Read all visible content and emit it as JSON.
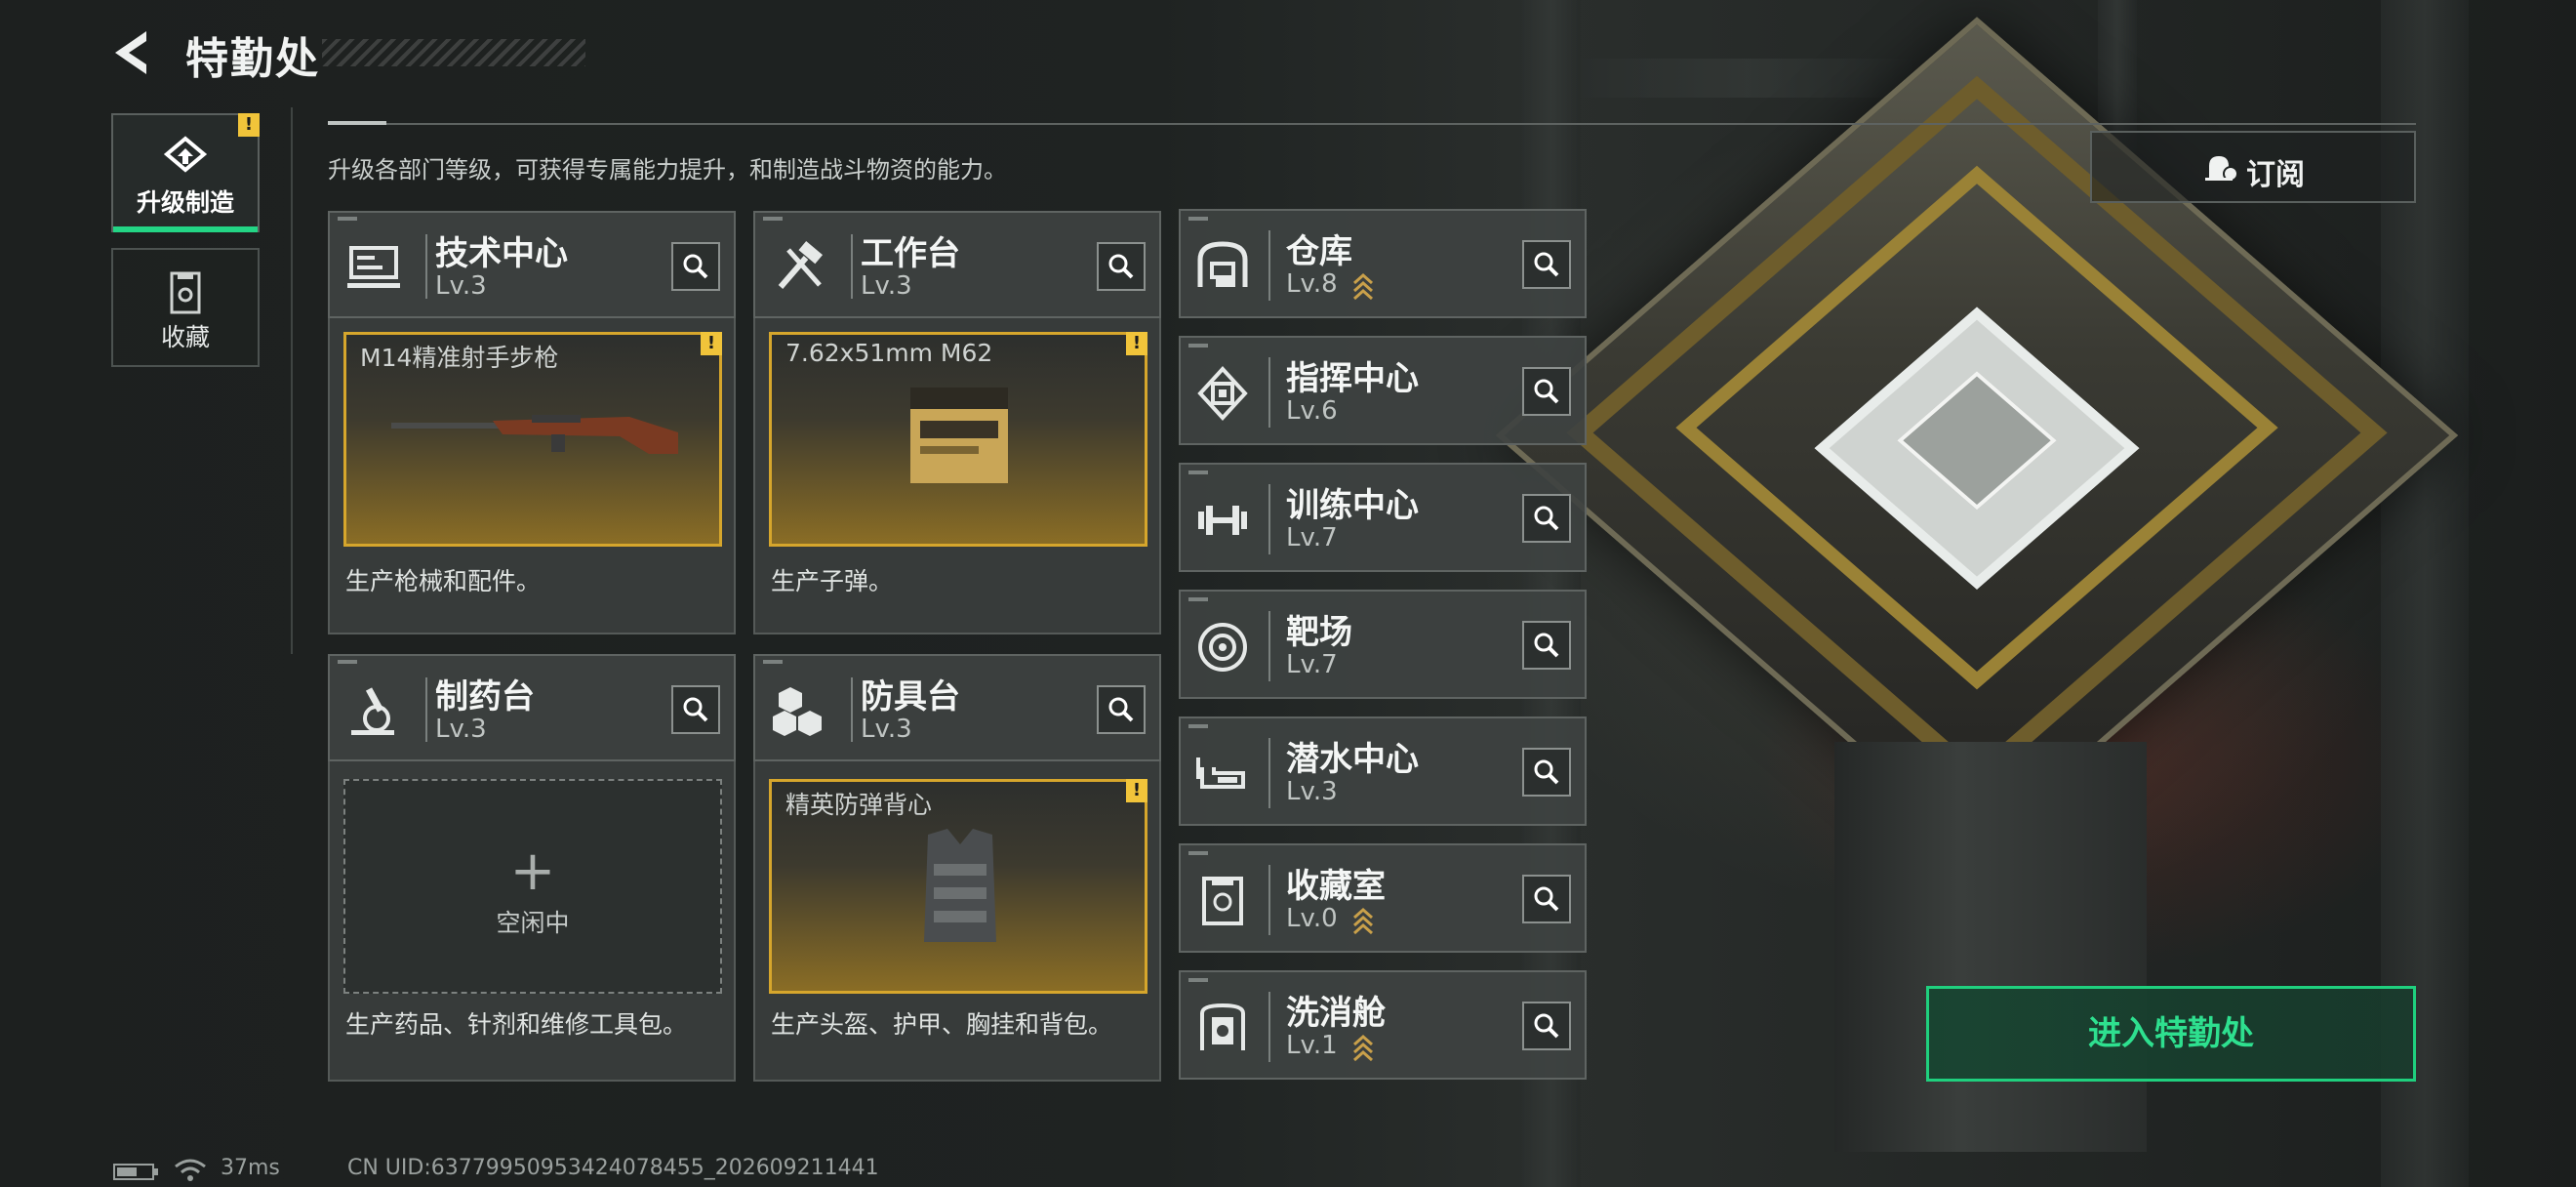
{
  "header": {
    "title": "特勤处",
    "subtitle": "升级各部门等级，可获得专属能力提升，和制造战斗物资的能力。"
  },
  "tabs": [
    {
      "label": "升级制造",
      "alert": "!"
    },
    {
      "label": "收藏"
    }
  ],
  "departments": [
    {
      "name": "技术中心",
      "level": "Lv.3",
      "slot_item": "M14精准射手步枪",
      "alert": "!",
      "description": "生产枪械和配件。"
    },
    {
      "name": "工作台",
      "level": "Lv.3",
      "slot_item": "7.62x51mm M62",
      "alert": "!",
      "description": "生产子弹。"
    },
    {
      "name": "制药台",
      "level": "Lv.3",
      "slot_empty_plus": "+",
      "slot_empty_text": "空闲中",
      "description": "生产药品、针剂和维修工具包。"
    },
    {
      "name": "防具台",
      "level": "Lv.3",
      "slot_item": "精英防弹背心",
      "alert": "!",
      "description": "生产头盔、护甲、胸挂和背包。"
    }
  ],
  "facilities": [
    {
      "name": "仓库",
      "level": "Lv.8",
      "upgradable": true
    },
    {
      "name": "指挥中心",
      "level": "Lv.6",
      "upgradable": false
    },
    {
      "name": "训练中心",
      "level": "Lv.7",
      "upgradable": false
    },
    {
      "name": "靶场",
      "level": "Lv.7",
      "upgradable": false
    },
    {
      "name": "潜水中心",
      "level": "Lv.3",
      "upgradable": false
    },
    {
      "name": "收藏室",
      "level": "Lv.0",
      "upgradable": true
    },
    {
      "name": "洗消舱",
      "level": "Lv.1",
      "upgradable": true
    }
  ],
  "subscribe_label": "订阅",
  "enter_label": "进入特勤处",
  "status": {
    "ping": "37ms",
    "uid": "CN UID:637799509534240784​55_202609211441"
  },
  "colors": {
    "accent": "#23d585",
    "alert": "#f1c43a",
    "slot_border": "#d6a62c"
  }
}
